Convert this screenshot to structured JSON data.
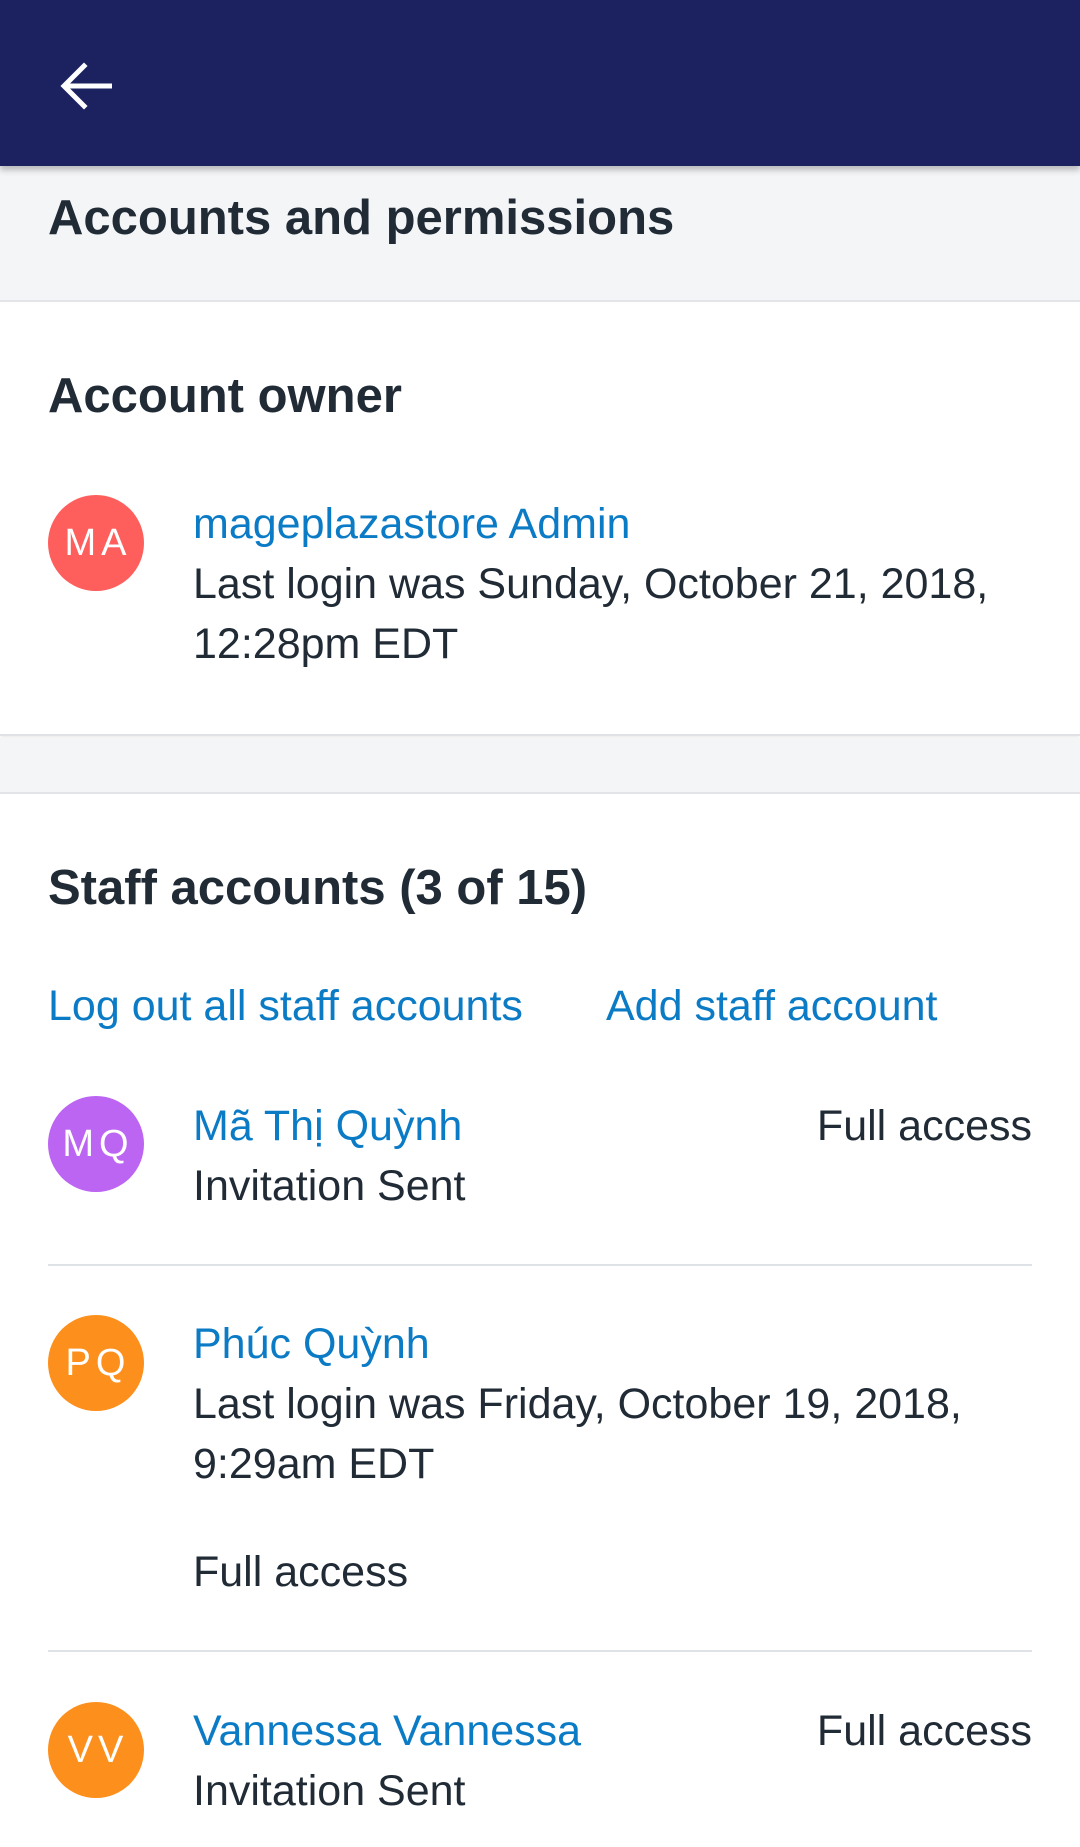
{
  "header": {
    "back_icon": "arrow-left-icon",
    "background": "#1c2260"
  },
  "page": {
    "title": "Accounts and permissions"
  },
  "owner_section": {
    "heading": "Account owner",
    "owner": {
      "initials": "MA",
      "avatar_color": "#fe5f5c",
      "name": "mageplazastore Admin",
      "last_login_line1": "Last login was Sunday, October 21, 2018,",
      "last_login_line2": "12:28pm EDT"
    }
  },
  "staff_section": {
    "heading": "Staff accounts (3 of 15)",
    "actions": {
      "logout_all": "Log out all staff accounts",
      "add_staff": "Add staff account"
    },
    "staff": [
      {
        "initials": "MQ",
        "avatar_color": "#bc65f2",
        "name": "Mã Thị Quỳnh",
        "status": "Invitation Sent",
        "access": "Full access"
      },
      {
        "initials": "PQ",
        "avatar_color": "#fd8f1c",
        "name": "Phúc Quỳnh",
        "last_login_line1": "Last login was Friday, October 19, 2018,",
        "last_login_line2": "9:29am EDT",
        "access": "Full access"
      },
      {
        "initials": "VV",
        "avatar_color": "#fd8f1c",
        "name": "Vannessa Vannessa",
        "status": "Invitation Sent",
        "access": "Full access"
      }
    ]
  }
}
